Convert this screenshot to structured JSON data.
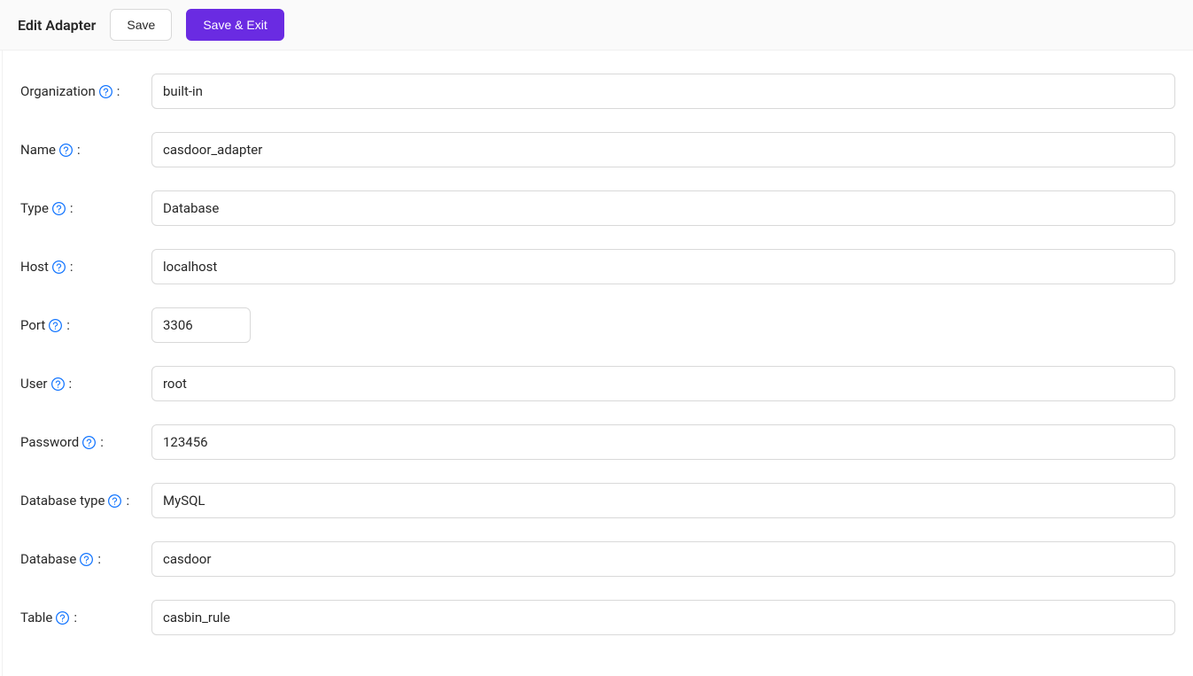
{
  "header": {
    "title": "Edit Adapter",
    "save_label": "Save",
    "save_exit_label": "Save & Exit"
  },
  "form": {
    "organization": {
      "label": "Organization",
      "value": "built-in"
    },
    "name": {
      "label": "Name",
      "value": "casdoor_adapter"
    },
    "type": {
      "label": "Type",
      "value": "Database"
    },
    "host": {
      "label": "Host",
      "value": "localhost"
    },
    "port": {
      "label": "Port",
      "value": "3306"
    },
    "user": {
      "label": "User",
      "value": "root"
    },
    "password": {
      "label": "Password",
      "value": "123456"
    },
    "database_type": {
      "label": "Database type",
      "value": "MySQL"
    },
    "database": {
      "label": "Database",
      "value": "casdoor"
    },
    "table": {
      "label": "Table",
      "value": "casbin_rule"
    }
  }
}
